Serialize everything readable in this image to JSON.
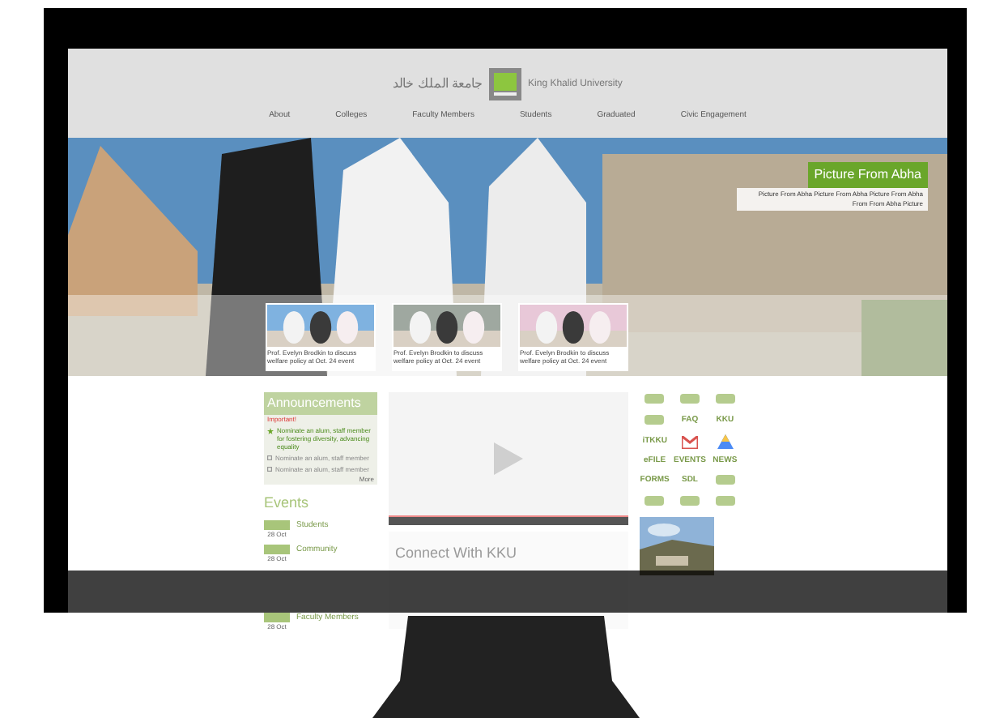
{
  "header": {
    "title_arabic": "جامعة الملك خالد",
    "title": "King Khalid University"
  },
  "nav": [
    {
      "label": "About"
    },
    {
      "label": "Colleges"
    },
    {
      "label": "Faculty Members"
    },
    {
      "label": "Students"
    },
    {
      "label": "Graduated"
    },
    {
      "label": "Civic Engagement"
    }
  ],
  "hero": {
    "caption_title": "Picture From Abha",
    "caption_text": "Picture From Abha Picture From Abha Picture From Abha From From Abha Picture",
    "news": [
      {
        "text": "Prof. Evelyn Brodkin to discuss welfare policy at Oct. 24 event"
      },
      {
        "text": "Prof. Evelyn Brodkin to discuss welfare policy at Oct. 24 event"
      },
      {
        "text": "Prof. Evelyn Brodkin to discuss welfare policy at Oct. 24 event"
      }
    ]
  },
  "announcements": {
    "title": "Announcements",
    "important_label": "Important!",
    "more": "More",
    "items": [
      {
        "text": "Nominate an alum, staff member for fostering diversity, advancing equality",
        "important": true
      },
      {
        "text": "Nominate an alum, staff member",
        "important": false
      },
      {
        "text": "Nominate an alum, staff member",
        "important": false
      }
    ]
  },
  "events": {
    "title": "Events",
    "items": [
      {
        "date": "28 Oct",
        "title": "Students"
      },
      {
        "date": "28 Oct",
        "title": "Community"
      },
      {
        "date": "28 Oct",
        "title": "Faculty Members"
      }
    ]
  },
  "connect": {
    "title": "Connect With KKU"
  },
  "links": [
    {
      "kind": "icon"
    },
    {
      "kind": "icon"
    },
    {
      "kind": "icon"
    },
    {
      "kind": "icon"
    },
    {
      "kind": "text",
      "label": "FAQ"
    },
    {
      "kind": "text",
      "label": "KKU"
    },
    {
      "kind": "text",
      "label": "iTKKU"
    },
    {
      "kind": "mail"
    },
    {
      "kind": "drive"
    },
    {
      "kind": "text",
      "label": "eFILE"
    },
    {
      "kind": "text",
      "label": "EVENTS"
    },
    {
      "kind": "text",
      "label": "NEWS"
    },
    {
      "kind": "text",
      "label": "FORMS"
    },
    {
      "kind": "text",
      "label": "SDL"
    },
    {
      "kind": "icon"
    },
    {
      "kind": "icon"
    },
    {
      "kind": "icon"
    },
    {
      "kind": "icon"
    }
  ]
}
